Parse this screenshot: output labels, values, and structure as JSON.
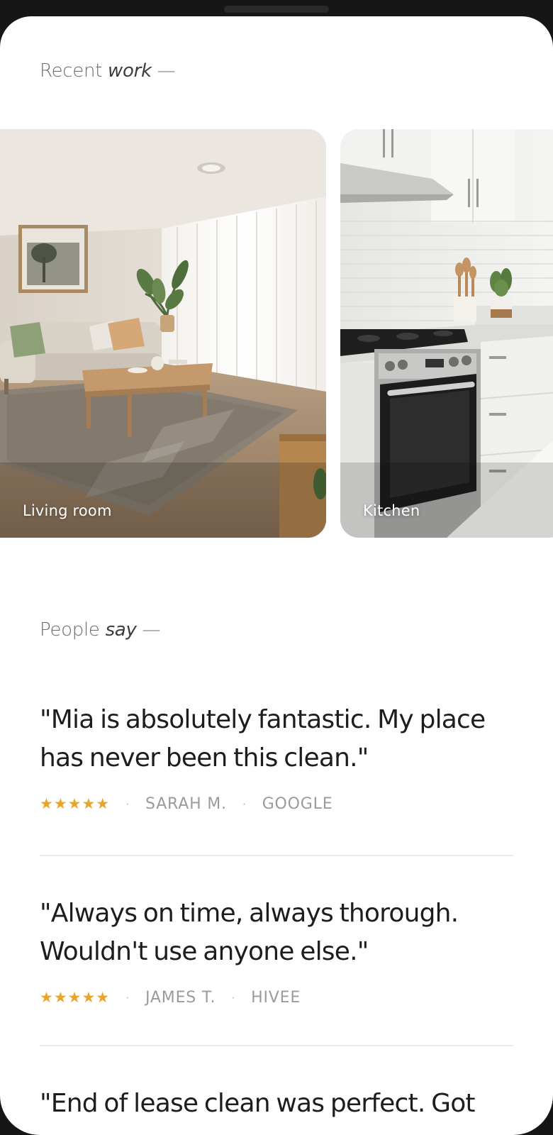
{
  "recent_work": {
    "heading_prefix": "Recent",
    "heading_emphasis": "work",
    "heading_suffix": " —",
    "cards": [
      {
        "label": "Living room",
        "image": "living-room-photo"
      },
      {
        "label": "Kitchen",
        "image": "kitchen-photo"
      }
    ]
  },
  "people_say": {
    "heading_prefix": "People",
    "heading_emphasis": "say",
    "heading_suffix": " —",
    "separator": "·",
    "reviews": [
      {
        "quote": "\"Mia is absolutely fantastic. My place has never been this clean.\"",
        "stars": "★★★★★",
        "author": "SARAH M.",
        "source": "GOOGLE"
      },
      {
        "quote": "\"Always on time, always thorough. Wouldn't use anyone else.\"",
        "stars": "★★★★★",
        "author": "JAMES T.",
        "source": "HIVEE"
      },
      {
        "quote": "\"End of lease clean was perfect. Got"
      }
    ]
  },
  "colors": {
    "star": "#e8a52a",
    "muted_text": "#9b9b9b",
    "heading_text": "#6b6b6b",
    "body_text": "#1d1d1d",
    "divider": "#ececec"
  }
}
